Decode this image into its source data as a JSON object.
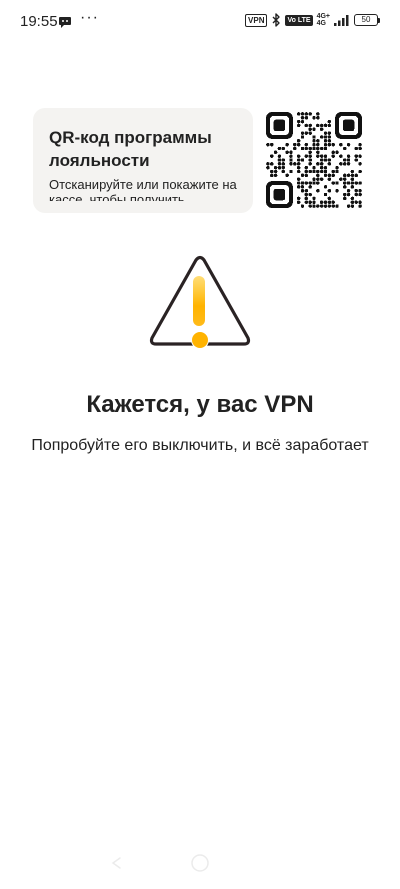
{
  "status_bar": {
    "time": "19:55",
    "more": "···",
    "vpn_badge": "VPN",
    "volte": "Vo LTE",
    "network_top": "4G+",
    "network_bottom": "4G",
    "battery": "50"
  },
  "loyalty": {
    "title": "QR-код программы лояльности",
    "subtitle": "Отсканируйте или покажите на кассе, чтобы получить"
  },
  "message": {
    "headline": "Кажется, у вас VPN",
    "body": "Попробуйте его выключить, и всё заработает"
  },
  "icons": {
    "chat": "chat-bubble-icon",
    "bluetooth": "bluetooth-icon",
    "signal": "signal-icon",
    "warning": "warning-triangle-icon",
    "qr": "qr-code-icon",
    "back": "back-gesture-icon",
    "home": "home-gesture-icon"
  },
  "colors": {
    "accent": "#FFB300",
    "card_bg": "#F4F3F1",
    "text": "#222222"
  }
}
